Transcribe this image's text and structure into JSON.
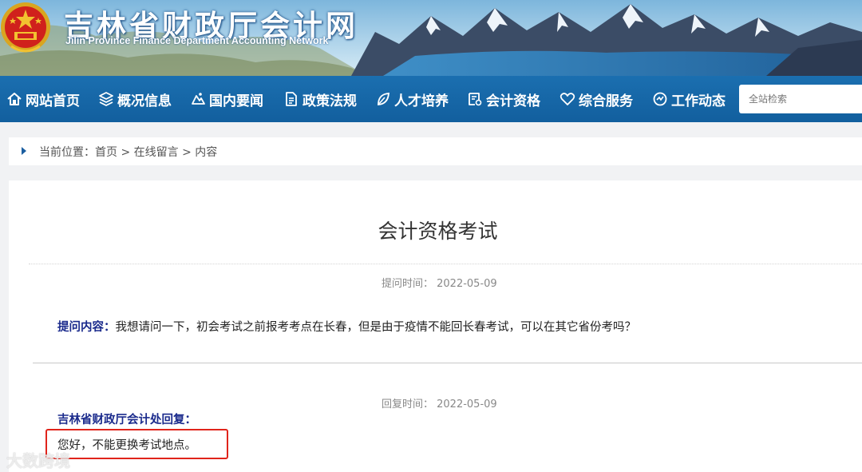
{
  "header": {
    "site_title": "吉林省财政厅会计网",
    "site_subtitle": "Jilin Province Finance Department Accounting Network"
  },
  "nav": {
    "items": [
      {
        "label": "网站首页",
        "icon": "home-icon"
      },
      {
        "label": "概况信息",
        "icon": "layers-icon"
      },
      {
        "label": "国内要闻",
        "icon": "news-icon"
      },
      {
        "label": "政策法规",
        "icon": "document-icon"
      },
      {
        "label": "人才培养",
        "icon": "leaf-icon"
      },
      {
        "label": "会计资格",
        "icon": "certificate-icon"
      },
      {
        "label": "综合服务",
        "icon": "heart-icon"
      },
      {
        "label": "工作动态",
        "icon": "activity-icon"
      }
    ],
    "search_placeholder": "全站检索"
  },
  "breadcrumb": {
    "prefix": "当前位置：",
    "home": "首页",
    "sep": " > ",
    "section": "在线留言",
    "current": "内容"
  },
  "article": {
    "title": "会计资格考试",
    "ask_time": "提问时间：  2022-05-09",
    "ask_label": "提问内容：",
    "ask_text": "我想请问一下，初会考试之前报考考点在长春，但是由于疫情不能回长春考试，可以在其它省份考吗？",
    "reply_time": "回复时间：  2022-05-09",
    "reply_label": "吉林省财政厅会计处回复：",
    "reply_text": "您好，不能更换考试地点。"
  },
  "watermark": "大数跨境",
  "colors": {
    "nav_bg": "#1b6fb0",
    "label_blue": "#1a2a8c",
    "highlight_red": "#e0241b"
  }
}
